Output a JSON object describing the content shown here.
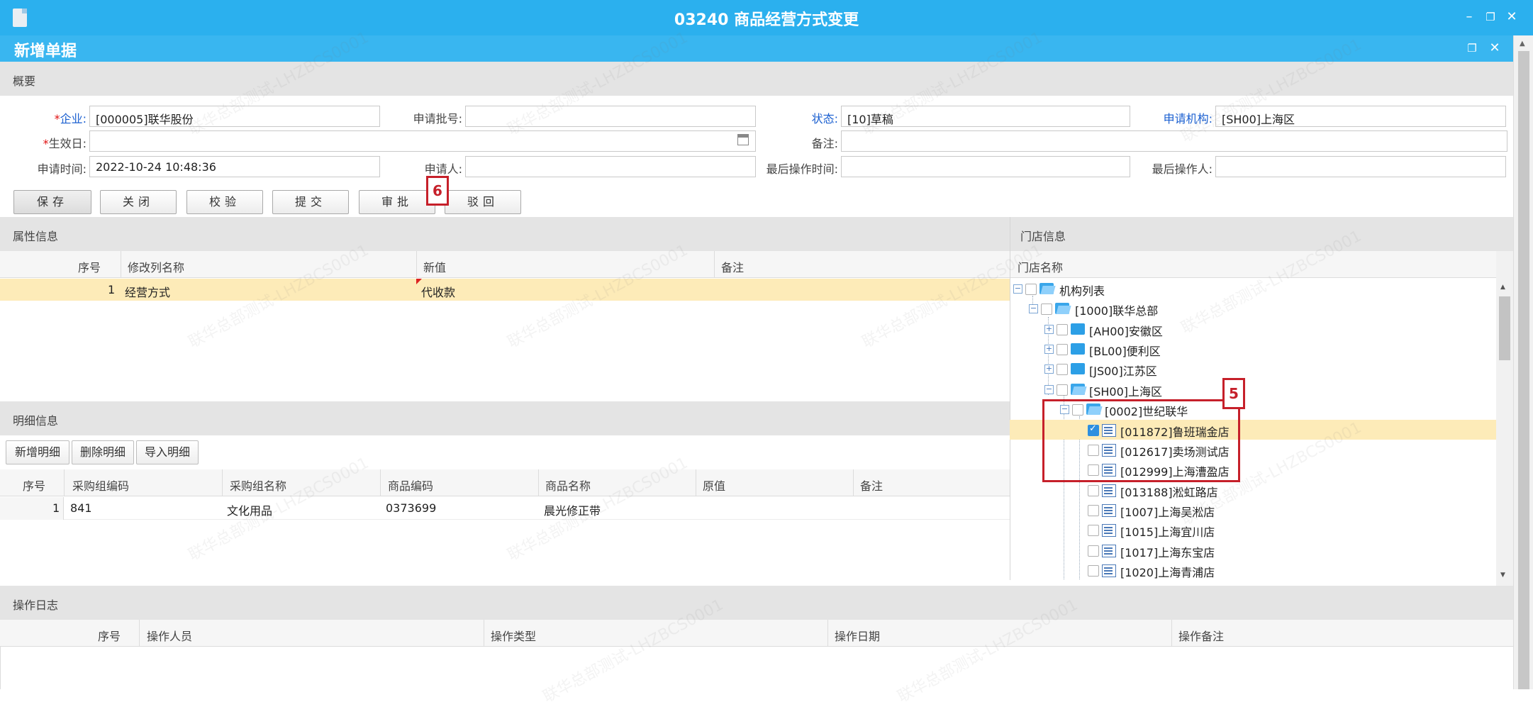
{
  "window": {
    "title": "03240 商品经营方式变更",
    "subtitle": "新增单据"
  },
  "summary": {
    "section_title": "概要",
    "enterprise_label": "企业:",
    "enterprise_value": "[000005]联华股份",
    "batch_label": "申请批号:",
    "batch_value": "",
    "status_label": "状态:",
    "status_value": "[10]草稿",
    "org_label": "申请机构:",
    "org_value": "[SH00]上海区",
    "effective_label": "生效日:",
    "effective_value": "",
    "remark_label": "备注:",
    "remark_value": "",
    "apply_time_label": "申请时间:",
    "apply_time_value": "2022-10-24 10:48:36",
    "applicant_label": "申请人:",
    "applicant_value": "",
    "last_op_time_label": "最后操作时间:",
    "last_op_time_value": "",
    "last_operator_label": "最后操作人:",
    "last_operator_value": ""
  },
  "toolbar": {
    "save": "保存",
    "close": "关闭",
    "verify": "校验",
    "submit": "提交",
    "approve": "审批",
    "reject": "驳回"
  },
  "attributes": {
    "section_title": "属性信息",
    "headers": [
      "序号",
      "修改列名称",
      "新值",
      "备注"
    ],
    "rows": [
      {
        "no": "1",
        "column": "经营方式",
        "new_value": "代收款",
        "remark": ""
      }
    ]
  },
  "details": {
    "section_title": "明细信息",
    "buttons": {
      "add": "新增明细",
      "delete": "删除明细",
      "import": "导入明细"
    },
    "headers": [
      "序号",
      "采购组编码",
      "采购组名称",
      "商品编码",
      "商品名称",
      "原值",
      "备注"
    ],
    "rows": [
      {
        "no": "1",
        "group_code": "841",
        "group_name": "文化用品",
        "item_code": "0373699",
        "item_name": "晨光修正带",
        "orig": "",
        "remark": ""
      }
    ]
  },
  "stores": {
    "section_title": "门店信息",
    "header": "门店名称",
    "tree": [
      {
        "label": "机构列表"
      },
      {
        "label": "[1000]联华总部"
      },
      {
        "label": "[AH00]安徽区"
      },
      {
        "label": "[BL00]便利区"
      },
      {
        "label": "[JS00]江苏区"
      },
      {
        "label": "[SH00]上海区"
      },
      {
        "label": "[0002]世纪联华"
      },
      {
        "label": "[011872]鲁班瑞金店",
        "checked": true
      },
      {
        "label": "[012617]卖场测试店"
      },
      {
        "label": "[012999]上海漕盈店"
      },
      {
        "label": "[013188]淞虹路店"
      },
      {
        "label": "[1007]上海吴淞店"
      },
      {
        "label": "[1015]上海宜川店"
      },
      {
        "label": "[1017]上海东宝店"
      },
      {
        "label": "[1020]上海青浦店"
      }
    ]
  },
  "oplog": {
    "section_title": "操作日志",
    "headers": [
      "序号",
      "操作人员",
      "操作类型",
      "操作日期",
      "操作备注"
    ]
  },
  "annotations": {
    "tag_5": "5",
    "tag_6": "6"
  },
  "watermark": "联华总部测试-LHZBCS0001",
  "colors": {
    "titlebar": "#2bb0ee",
    "selected_row": "#fdebb8",
    "annotation": "#c6202a"
  }
}
